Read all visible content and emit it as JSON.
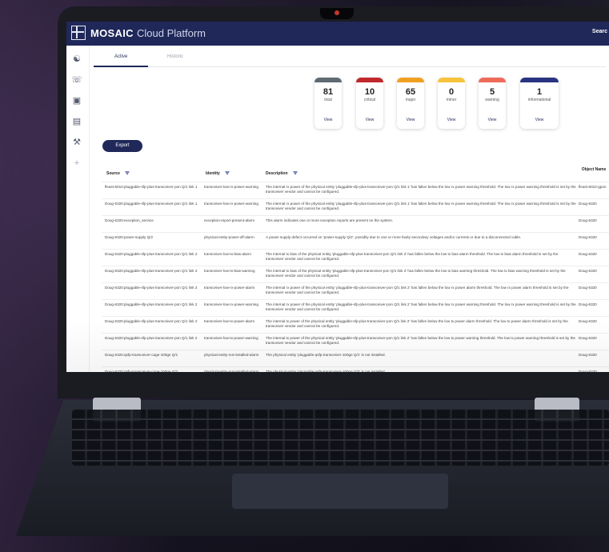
{
  "app": {
    "brand": "MOSAIC",
    "brand_sub": "Cloud Platform",
    "search": "Searc"
  },
  "sidebar": {
    "items": [
      {
        "icon": "users-icon"
      },
      {
        "icon": "headset-icon"
      },
      {
        "icon": "calendar-icon"
      },
      {
        "icon": "clipboard-icon"
      },
      {
        "icon": "wrench-icon"
      },
      {
        "icon": "plus-icon"
      }
    ]
  },
  "tabs": [
    {
      "label": "Active"
    },
    {
      "label": "Historic"
    }
  ],
  "summary": [
    {
      "count": "81",
      "label": "total",
      "view": "View",
      "color": "#5f6b73"
    },
    {
      "count": "10",
      "label": "critical",
      "view": "View",
      "color": "#c0282d"
    },
    {
      "count": "65",
      "label": "major",
      "view": "View",
      "color": "#f0a020"
    },
    {
      "count": "0",
      "label": "minor",
      "view": "View",
      "color": "#f6c33c"
    },
    {
      "count": "5",
      "label": "warning",
      "view": "View",
      "color": "#ee6a5a"
    },
    {
      "count": "1",
      "label": "informational",
      "view": "View",
      "color": "#2a3480"
    }
  ],
  "export_label": "Export",
  "table": {
    "headers": {
      "source": "Source",
      "identity": "Identity",
      "description": "Description",
      "object_name": "Object Name"
    },
    "rows": [
      {
        "source": "fleast-6010:pluggable-sfp-plus-transceiver-pon Q/1 link 1",
        "identity": "transceiver-low-rx-power-warning",
        "description": "The internal rx power of the physical entity 'pluggable-sfp-plus-transceiver-pon Q/1 link 1' has fallen below the low rx power warning threshold. The low rx power warning threshold is set by the transceiver vendor and cannot be configured.",
        "object": "fleast-6010-gpon"
      },
      {
        "source": "Doug-6320:pluggable-sfp-plus-transceiver-pon Q/1 link 1",
        "identity": "transceiver-low-rx-power-warning",
        "description": "The internal rx power of the physical entity 'pluggable-sfp-plus-transceiver-pon Q/1 link 1' has fallen below the low rx power warning threshold. The low rx power warning threshold is set by the transceiver vendor and cannot be configured.",
        "object": "Doug-6320"
      },
      {
        "source": "Doug-6320:exception_service",
        "identity": "exception-report-present-alarm",
        "description": "This alarm indicates one or more exception reports are present on the system.",
        "object": "Doug-6320"
      },
      {
        "source": "Doug-6320:power-supply Q/2",
        "identity": "physical-entity-power-off-alarm",
        "description": "A power supply defect occurred on 'power-supply Q/2', possibly due to one or more faulty secondary voltages and/or currents or due to a disconnected cable.",
        "object": "Doug-6320"
      },
      {
        "source": "Doug-6320:pluggable-sfp-plus-transceiver-pon Q/1 link 2",
        "identity": "transceiver-low-tx-bias-alarm",
        "description": "The internal tx bias of the physical entity 'pluggable-sfp-plus-transceiver-pon Q/1 link 2' has fallen below the low tx bias alarm threshold. The low tx bias alarm threshold is set by the transceiver vendor and cannot be configured.",
        "object": "Doug-6320"
      },
      {
        "source": "Doug-6320:pluggable-sfp-plus-transceiver-pon Q/1 link 2",
        "identity": "transceiver-low-tx-bias-warning",
        "description": "The internal tx bias of the physical entity 'pluggable-sfp-plus-transceiver-pon Q/1 link 2' has fallen below the low tx bias warning threshold. The low tx bias warning threshold is set by the transceiver vendor and cannot be configured.",
        "object": "Doug-6320"
      },
      {
        "source": "Doug-6320:pluggable-sfp-plus-transceiver-pon Q/1 link 2",
        "identity": "transceiver-low-rx-power-alarm",
        "description": "The internal rx power of the physical entity 'pluggable-sfp-plus-transceiver-pon Q/1 link 2' has fallen below the low rx power alarm threshold. The low rx power alarm threshold is set by the transceiver vendor and cannot be configured.",
        "object": "Doug-6320"
      },
      {
        "source": "Doug-6320:pluggable-sfp-plus-transceiver-pon Q/1 link 2",
        "identity": "transceiver-low-rx-power-warning",
        "description": "The internal rx power of the physical entity 'pluggable-sfp-plus-transceiver-pon Q/1 link 2' has fallen below the low rx power warning threshold. The low rx power warning threshold is set by the transceiver vendor and cannot be configured.",
        "object": "Doug-6320"
      },
      {
        "source": "Doug-6320:pluggable-sfp-plus-transceiver-pon Q/1 link 2",
        "identity": "transceiver-low-tx-power-alarm",
        "description": "The internal tx power of the physical entity 'pluggable-sfp-plus-transceiver-pon Q/1 link 2' has fallen below the low tx power alarm threshold. The low tx power alarm threshold is set by the transceiver vendor and cannot be configured.",
        "object": "Doug-6320"
      },
      {
        "source": "Doug-6320:pluggable-sfp-plus-transceiver-pon Q/1 link 2",
        "identity": "transceiver-low-tx-power-warning",
        "description": "The internal tx power of the physical entity 'pluggable-sfp-plus-transceiver-pon Q/1 link 2' has fallen below the low tx power warning threshold. The low tx power warning threshold is set by the transceiver vendor and cannot be configured.",
        "object": "Doug-6320"
      },
      {
        "source": "Doug-6320:qsfp-transceiver-cage-100ge Q/1",
        "identity": "physical-entity-not-installed-alarm",
        "description": "The physical entity 'pluggable-qsfp-transceiver-100ge Q/1' is not installed.",
        "object": "Doug-6320"
      },
      {
        "source": "Doug-6320:qsfp-transceiver-cage-100ge Q/2",
        "identity": "physical-entity-not-installed-alarm",
        "description": "The physical entity 'pluggable-qsfp-transceiver-100ge Q/2' is not installed.",
        "object": "Doug-6320"
      }
    ]
  }
}
